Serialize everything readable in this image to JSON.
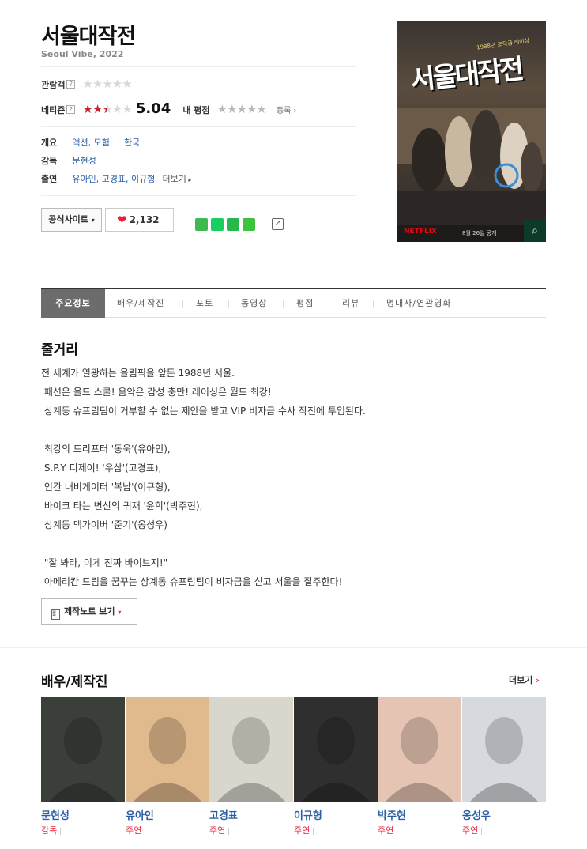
{
  "movie": {
    "title": "서울대작전",
    "subtitle": "Seoul Vibe, 2022"
  },
  "ratings": {
    "audience_label": "관람객",
    "audience_stars": 0,
    "netizen_label": "네티즌",
    "netizen_score": "5.04",
    "netizen_stars_fraction": 0.504,
    "my_rating_label": "내 평점",
    "register_label": "등록"
  },
  "info": {
    "overview_label": "개요",
    "genres": [
      "액션",
      "모험"
    ],
    "country": "한국",
    "director_label": "감독",
    "director": "문현성",
    "cast_label": "출연",
    "cast": "유아인, 고경표, 이규형",
    "more_label": "더보기"
  },
  "actions": {
    "official_site_label": "공식사이트",
    "like_count": "2,132",
    "help_glyph": "?",
    "share_colors": [
      "#3fb950",
      "#19ce60",
      "#27b84a",
      "#3ec43c"
    ]
  },
  "poster": {
    "title": "서울대작전",
    "tagline": "1988년 조작급 레이싱",
    "brand": "NETFLIX",
    "date": "8월 26일 공개"
  },
  "tabs": [
    {
      "label": "주요정보",
      "active": true
    },
    {
      "label": "배우/제작진",
      "active": false
    },
    {
      "label": "포토",
      "active": false
    },
    {
      "label": "동영상",
      "active": false
    },
    {
      "label": "평점",
      "active": false
    },
    {
      "label": "리뷰",
      "active": false
    },
    {
      "label": "명대사/연관영화",
      "active": false
    }
  ],
  "synopsis": {
    "heading": "줄거리",
    "lines": [
      "전 세계가 열광하는 올림픽을 앞둔 1988년 서울.",
      " 패션은 올드 스쿨! 음악은 감성 충만! 레이싱은 월드 최강!",
      " 상계동 슈프림팀이 거부할 수 없는 제안을 받고 VIP 비자금 수사 작전에 투입된다.",
      "",
      " 최강의 드리프터 '동욱'(유아인),",
      " S.P.Y 디제이! '우삼'(고경표),",
      " 인간 내비게이터 '복남'(이규형),",
      " 바이크 타는 변신의 귀재 '윤희'(박주현),",
      " 상계동 맥가이버 '준기'(옹성우)",
      "",
      " \"잘 봐라, 이게 진짜 바이브지!\"",
      " 아메리칸 드림을 꿈꾸는 상계동 슈프림팀이 비자금을 싣고 서울을 질주한다!"
    ],
    "note_button": "제작노트 보기"
  },
  "cast_section": {
    "heading": "배우/제작진",
    "more_label": "더보기",
    "people": [
      {
        "name": "문현성",
        "role": "감독",
        "bg": "#3b3f3a"
      },
      {
        "name": "유아인",
        "role": "주연",
        "bg": "#e0b98c"
      },
      {
        "name": "고경표",
        "role": "주연",
        "bg": "#d9d6cc"
      },
      {
        "name": "이규형",
        "role": "주연",
        "bg": "#2f2f2f"
      },
      {
        "name": "박주현",
        "role": "주연",
        "bg": "#e6c4b3"
      },
      {
        "name": "옹성우",
        "role": "주연",
        "bg": "#d6d9de"
      }
    ]
  }
}
